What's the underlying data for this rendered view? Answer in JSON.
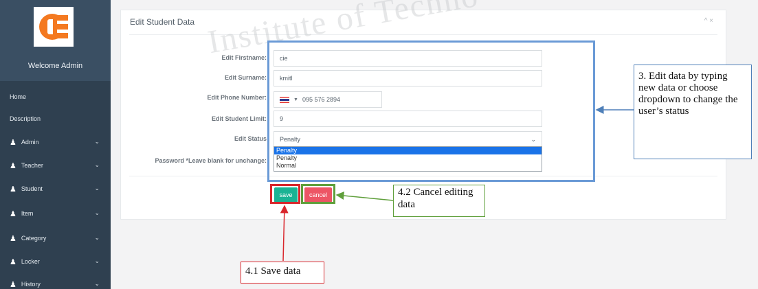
{
  "sidebar": {
    "welcome": "Welcome Admin",
    "items": [
      {
        "label": "Home"
      },
      {
        "label": "Description"
      },
      {
        "label": "Admin"
      },
      {
        "label": "Teacher"
      },
      {
        "label": "Student"
      },
      {
        "label": "Item"
      },
      {
        "label": "Category"
      },
      {
        "label": "Locker"
      },
      {
        "label": "History"
      }
    ]
  },
  "panel": {
    "title": "Edit Student Data",
    "tools": "^ ×"
  },
  "form": {
    "firstname_label": "Edit Firstname:",
    "firstname_value": "cie",
    "surname_label": "Edit Surname:",
    "surname_value": "kmitl",
    "phone_label": "Edit Phone Number:",
    "phone_value": "095 576 2894",
    "limit_label": "Edit Student Limit:",
    "limit_value": "9",
    "status_label": "Edit Status",
    "status_value": "Penalty",
    "status_options": [
      "Penalty",
      "Penalty",
      "Normal"
    ],
    "password_label": "Password *Leave blank for unchange:"
  },
  "buttons": {
    "save": "save",
    "cancel": "cancel"
  },
  "annotations": {
    "edit_note": "3. Edit data by typing new data or choose dropdown to change the user’s status",
    "cancel_note": "4.2 Cancel editing data",
    "save_note": "4.1 Save data"
  },
  "watermark": "Institute of Techno",
  "colors": {
    "sidebar": "#2f4050",
    "save": "#1ab394",
    "cancel": "#ed5565",
    "highlight": "#6a9ad6",
    "save_highlight": "#d9262c",
    "cancel_highlight": "#5f9f3b"
  },
  "icons": {
    "nav": "user-icon",
    "nav_chevron": "chevron-down-icon",
    "select_caret": "chevron-down-icon"
  }
}
